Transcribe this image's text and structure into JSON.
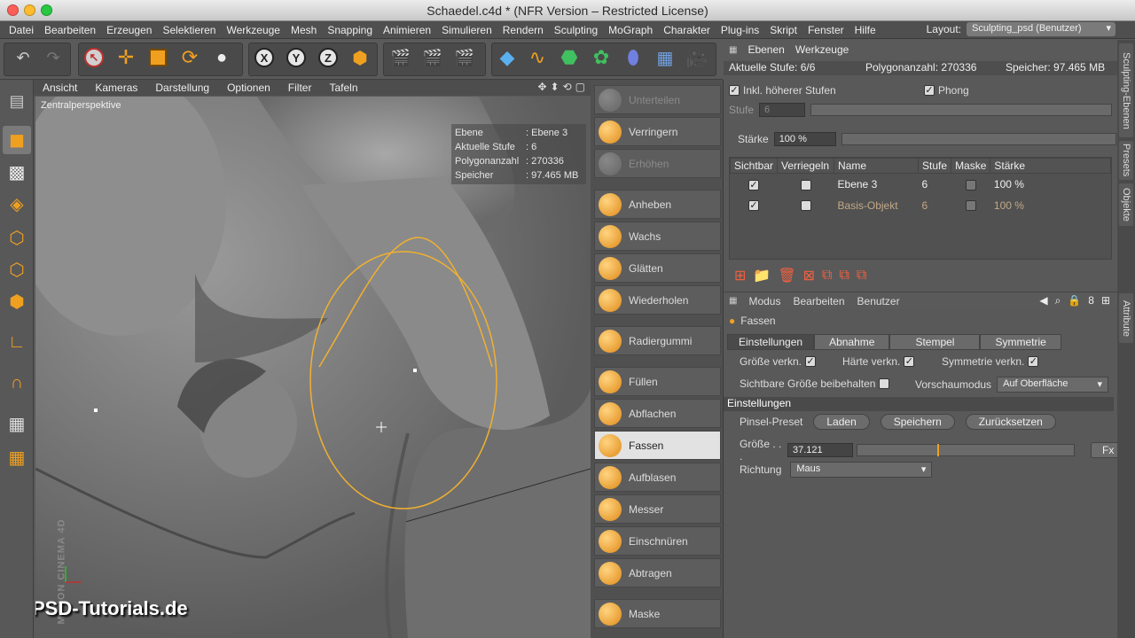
{
  "window": {
    "title": "Schaedel.c4d * (NFR Version – Restricted License)",
    "traffic_colors": [
      "#fc5f57",
      "#fdbc2e",
      "#28c840"
    ]
  },
  "menubar": {
    "items": [
      "Datei",
      "Bearbeiten",
      "Erzeugen",
      "Selektieren",
      "Werkzeuge",
      "Mesh",
      "Snapping",
      "Animieren",
      "Simulieren",
      "Rendern",
      "Sculpting",
      "MoGraph",
      "Charakter",
      "Plug-ins",
      "Skript",
      "Fenster",
      "Hilfe"
    ],
    "layout_label": "Layout:",
    "layout_value": "Sculpting_psd (Benutzer)"
  },
  "toolbar": {
    "icons": [
      "undo-icon",
      "redo-icon",
      "select-icon",
      "move-icon",
      "scale-icon",
      "rotate-icon",
      "live-select-icon",
      "x-axis-icon",
      "y-axis-icon",
      "z-axis-icon",
      "coordinate-system-icon",
      "render-view-icon",
      "render-picture-viewer-icon",
      "render-settings-icon",
      "cube-object-icon",
      "spline-icon",
      "subdivision-icon",
      "array-icon",
      "deformer-icon",
      "environment-icon",
      "camera-icon"
    ],
    "axis_labels": [
      "X",
      "Y",
      "Z"
    ]
  },
  "viewport": {
    "menu": [
      "Ansicht",
      "Kameras",
      "Darstellung",
      "Optionen",
      "Filter",
      "Tafeln"
    ],
    "label": "Zentralperspektive",
    "hud": [
      {
        "k": "Ebene",
        "v": ": Ebene 3"
      },
      {
        "k": "Aktuelle Stufe",
        "v": ": 6"
      },
      {
        "k": "Polygonanzahl",
        "v": ": 270336"
      },
      {
        "k": "Speicher",
        "v": ": 97.465 MB"
      }
    ],
    "watermark": "PSD-Tutorials.de",
    "maxon": "MAXON CINEMA 4D",
    "brush_color": "#f0b030"
  },
  "brushes": [
    {
      "label": "Unterteilen",
      "disabled": true
    },
    {
      "label": "Verringern",
      "disabled": false
    },
    {
      "label": "Erhöhen",
      "disabled": true
    },
    {
      "label": "Anheben",
      "disabled": false
    },
    {
      "label": "Wachs",
      "disabled": false
    },
    {
      "label": "Glätten",
      "disabled": false
    },
    {
      "label": "Wiederholen",
      "disabled": false
    },
    {
      "label": "Radiergummi",
      "disabled": false
    },
    {
      "label": "Füllen",
      "disabled": false
    },
    {
      "label": "Abflachen",
      "disabled": false
    },
    {
      "label": "Fassen",
      "disabled": false,
      "active": true
    },
    {
      "label": "Aufblasen",
      "disabled": false
    },
    {
      "label": "Messer",
      "disabled": false
    },
    {
      "label": "Einschnüren",
      "disabled": false
    },
    {
      "label": "Abtragen",
      "disabled": false
    },
    {
      "label": "Maske",
      "disabled": false
    }
  ],
  "layers_panel": {
    "tabs": [
      "Ebenen",
      "Werkzeuge"
    ],
    "info": {
      "stufe": "Aktuelle Stufe:  6/6",
      "poly": "Polygonanzahl: 270336",
      "mem": "Speicher:  97.465 MB"
    },
    "inkl_label": "Inkl. höherer Stufen",
    "phong_label": "Phong",
    "stufe_label": "Stufe",
    "stufe_value": "6",
    "staerke_label": "Stärke",
    "staerke_value": "100 %",
    "columns": [
      "Sichtbar",
      "Verriegeln",
      "Name",
      "Stufe",
      "Maske",
      "Stärke"
    ],
    "rows": [
      {
        "name": "Ebene 3",
        "stufe": "6",
        "staerke": "100 %",
        "visible": true,
        "dim": false
      },
      {
        "name": "Basis-Objekt",
        "stufe": "6",
        "staerke": "100 %",
        "visible": true,
        "dim": true
      }
    ]
  },
  "attributes": {
    "menu": [
      "Modus",
      "Bearbeiten",
      "Benutzer"
    ],
    "tool_name": "Fassen",
    "subtabs": [
      "Einstellungen",
      "Abnahme",
      "Stempel",
      "Symmetrie"
    ],
    "groesse_verkn": "Größe verkn.",
    "haerte_verkn": "Härte verkn.",
    "symmetrie_verkn": "Symmetrie verkn.",
    "sichtbare_groesse": "Sichtbare Größe beibehalten",
    "vorschau_label": "Vorschaumodus",
    "vorschau_value": "Auf Oberfläche",
    "section_title": "Einstellungen",
    "pinsel_label": "Pinsel-Preset",
    "pinsel_buttons": [
      "Laden",
      "Speichern",
      "Zurücksetzen"
    ],
    "groesse_label": "Größe . . .",
    "groesse_value": "37.121",
    "groesse_fraction": 0.37,
    "fx_label": "Fx",
    "richtung_label": "Richtung",
    "richtung_value": "Maus"
  },
  "sidetabs": [
    "Sculpting-Ebenen",
    "Presets",
    "Objekte",
    "Attribute"
  ]
}
